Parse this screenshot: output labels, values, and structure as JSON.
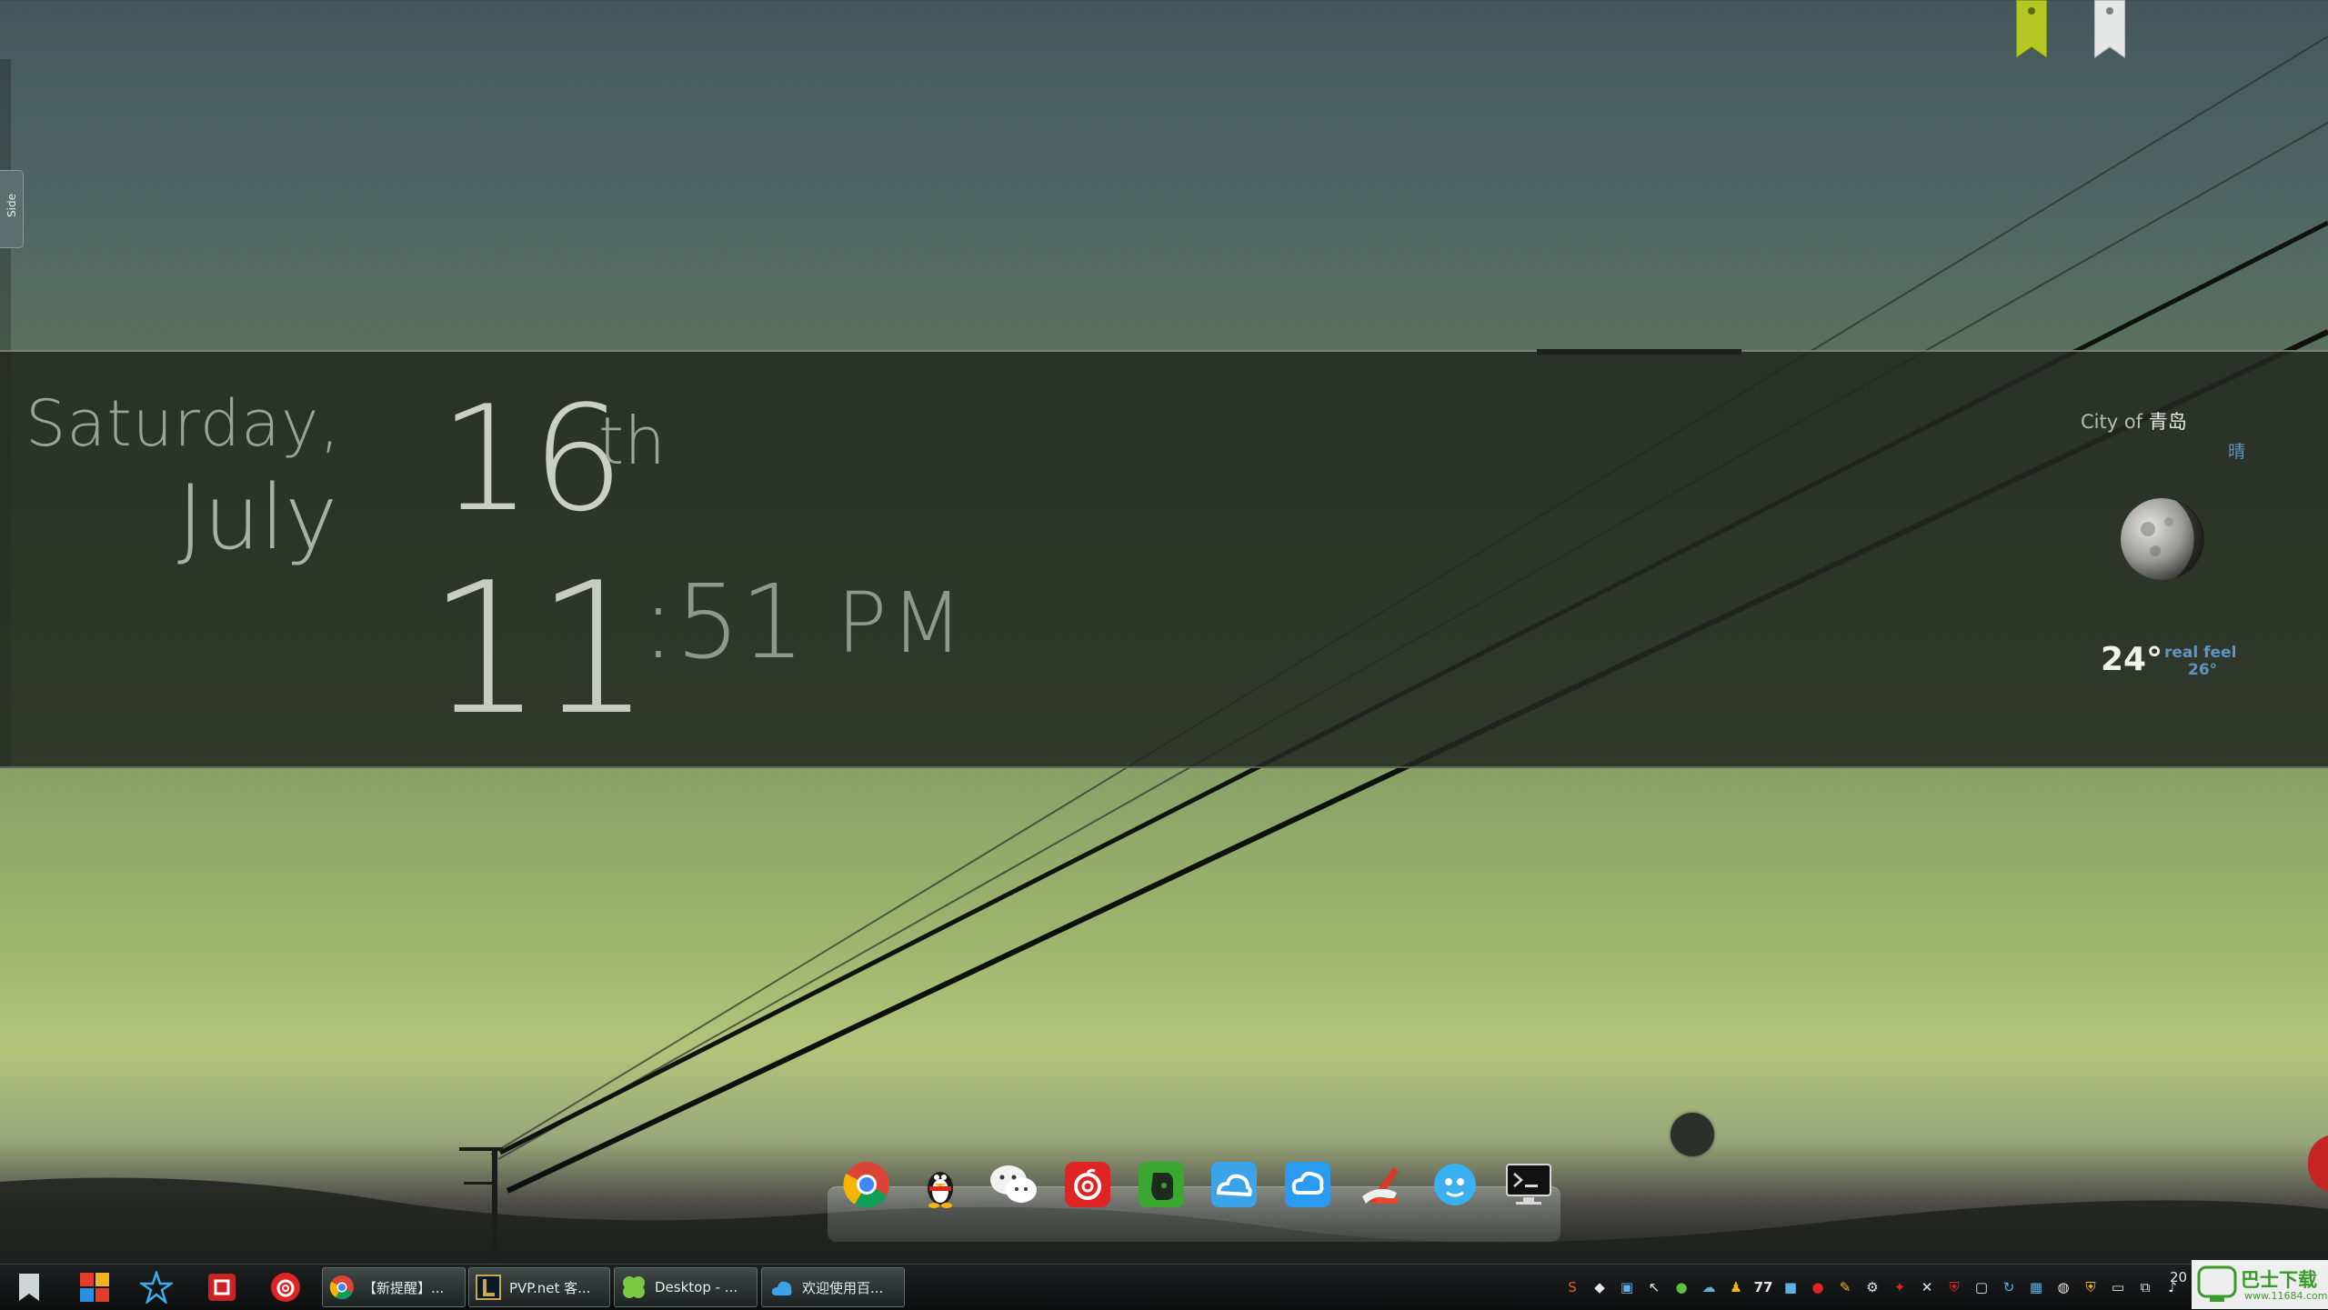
{
  "side_tab": {
    "label": "Side"
  },
  "widget": {
    "weekday": "Saturday,",
    "month": "July",
    "day": "16",
    "day_suffix": "th",
    "hour": "11",
    "minute": ":51",
    "ampm": "PM"
  },
  "weather": {
    "city_prefix": "City of",
    "city": "青岛",
    "condition": "晴",
    "temperature": "24°",
    "realfeel_label": "real feel",
    "realfeel_value": "26°",
    "icon": "moon-icon"
  },
  "dock": {
    "items": [
      {
        "name": "chrome",
        "icon": "chrome-icon"
      },
      {
        "name": "qq",
        "icon": "qq-penguin-icon"
      },
      {
        "name": "wechat",
        "icon": "wechat-icon"
      },
      {
        "name": "netease-music",
        "icon": "netease-music-icon"
      },
      {
        "name": "evernote",
        "icon": "evernote-icon"
      },
      {
        "name": "baidu-cloud",
        "icon": "baidu-cloud-icon"
      },
      {
        "name": "cloud-drive",
        "icon": "cloud-drive-icon"
      },
      {
        "name": "ccleaner",
        "icon": "ccleaner-icon"
      },
      {
        "name": "bubble-app",
        "icon": "blue-bubble-icon"
      },
      {
        "name": "console",
        "icon": "terminal-icon"
      }
    ]
  },
  "taskbar": {
    "pinned": [
      "bookmark-icon",
      "colorful-tiles-icon",
      "star-icon",
      "red-square-icon",
      "netease-music-icon"
    ],
    "tasks": [
      {
        "label": "【新提醒】...",
        "icon": "chrome-icon"
      },
      {
        "label": "PVP.net 客...",
        "icon": "league-icon"
      },
      {
        "label": "Desktop - ...",
        "icon": "clover-icon"
      },
      {
        "label": "欢迎使用百...",
        "icon": "baidu-cloud-icon"
      }
    ],
    "clock_fragment": "20"
  },
  "watermark": {
    "title": "巴士下载",
    "url": "www.11684.com"
  },
  "colors": {
    "accent_blue": "#5f95c5",
    "banner_bg": "#232821",
    "bookmark_green": "#b3c822",
    "bookmark_white": "#e4e7e6"
  }
}
